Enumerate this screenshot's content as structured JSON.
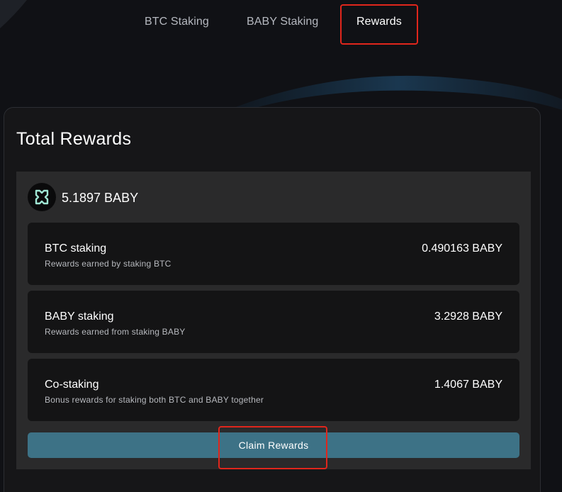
{
  "tabs": [
    {
      "label": "BTC Staking",
      "active": false
    },
    {
      "label": "BABY Staking",
      "active": false
    },
    {
      "label": "Rewards",
      "active": true
    }
  ],
  "rewards": {
    "title": "Total Rewards",
    "token_icon": "babylon-logo-icon",
    "total": "5.1897 BABY",
    "items": [
      {
        "title": "BTC staking",
        "subtitle": "Rewards earned by staking BTC",
        "amount": "0.490163 BABY"
      },
      {
        "title": "BABY staking",
        "subtitle": "Rewards earned from staking BABY",
        "amount": "3.2928 BABY"
      },
      {
        "title": "Co-staking",
        "subtitle": "Bonus rewards for staking both BTC and BABY together",
        "amount": "1.4067 BABY"
      }
    ],
    "claim_label": "Claim Rewards"
  },
  "colors": {
    "background": "#101115",
    "card": "#161618",
    "panel": "#2a2a2b",
    "row": "#141415",
    "button": "#3d7286",
    "highlight": "#e0261c"
  }
}
